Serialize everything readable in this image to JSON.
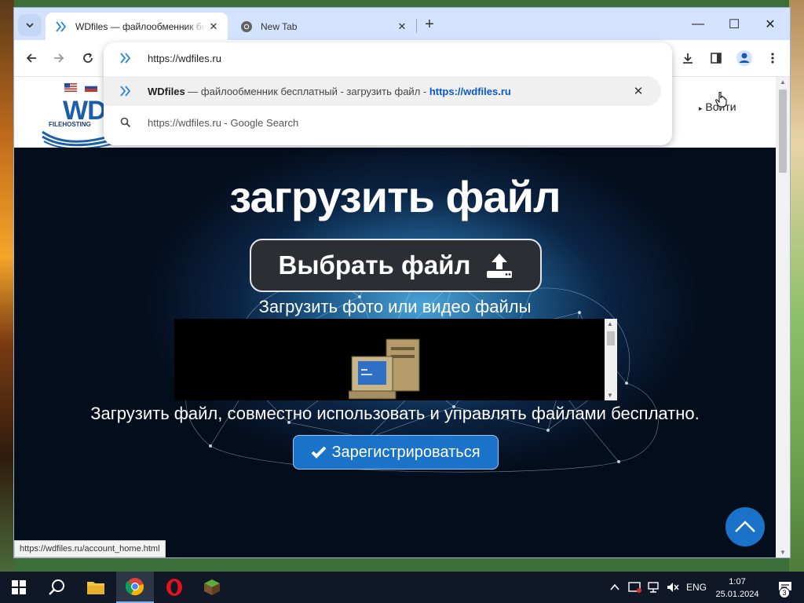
{
  "browser": {
    "tabs": [
      {
        "title": "WDfiles — файлообменник бе",
        "active": true
      },
      {
        "title": "New Tab",
        "active": false
      }
    ],
    "new_tab_symbol": "+",
    "close_symbol": "✕",
    "window_controls": {
      "minimize": "—",
      "maximize": "☐",
      "close": "✕"
    }
  },
  "omnibox": {
    "input_value": "https://wdfiles.ru",
    "suggestions": [
      {
        "title": "WDfiles",
        "dash": " — ",
        "description": "файлообменник бесплатный - загрузить файл - ",
        "url": "https://wdfiles.ru"
      },
      {
        "text": "https://wdfiles.ru",
        "suffix": " - Google Search"
      }
    ]
  },
  "site": {
    "logo": {
      "text": "WD",
      "sub": "FILEHOSTING"
    },
    "login_label": "Войти",
    "hero_title": "загрузить файл",
    "choose_file_label": "Выбрать файл",
    "upload_hint": "Загрузить фото или видео файлы",
    "description": "Загрузить файл, совместно использовать и управлять файлами бесплатно.",
    "register_label": "Зарегистрироваться"
  },
  "status_bar_url": "https://wdfiles.ru/account_home.html",
  "taskbar": {
    "language": "ENG",
    "time": "1:07",
    "date": "25.01.2024",
    "notification_count": "3",
    "apps": [
      "windows-start",
      "search",
      "file-explorer",
      "chrome",
      "opera",
      "minecraft"
    ]
  },
  "colors": {
    "accent": "#1a73c9",
    "tabstrip": "#d3e3fd",
    "link": "#0b57d0"
  }
}
